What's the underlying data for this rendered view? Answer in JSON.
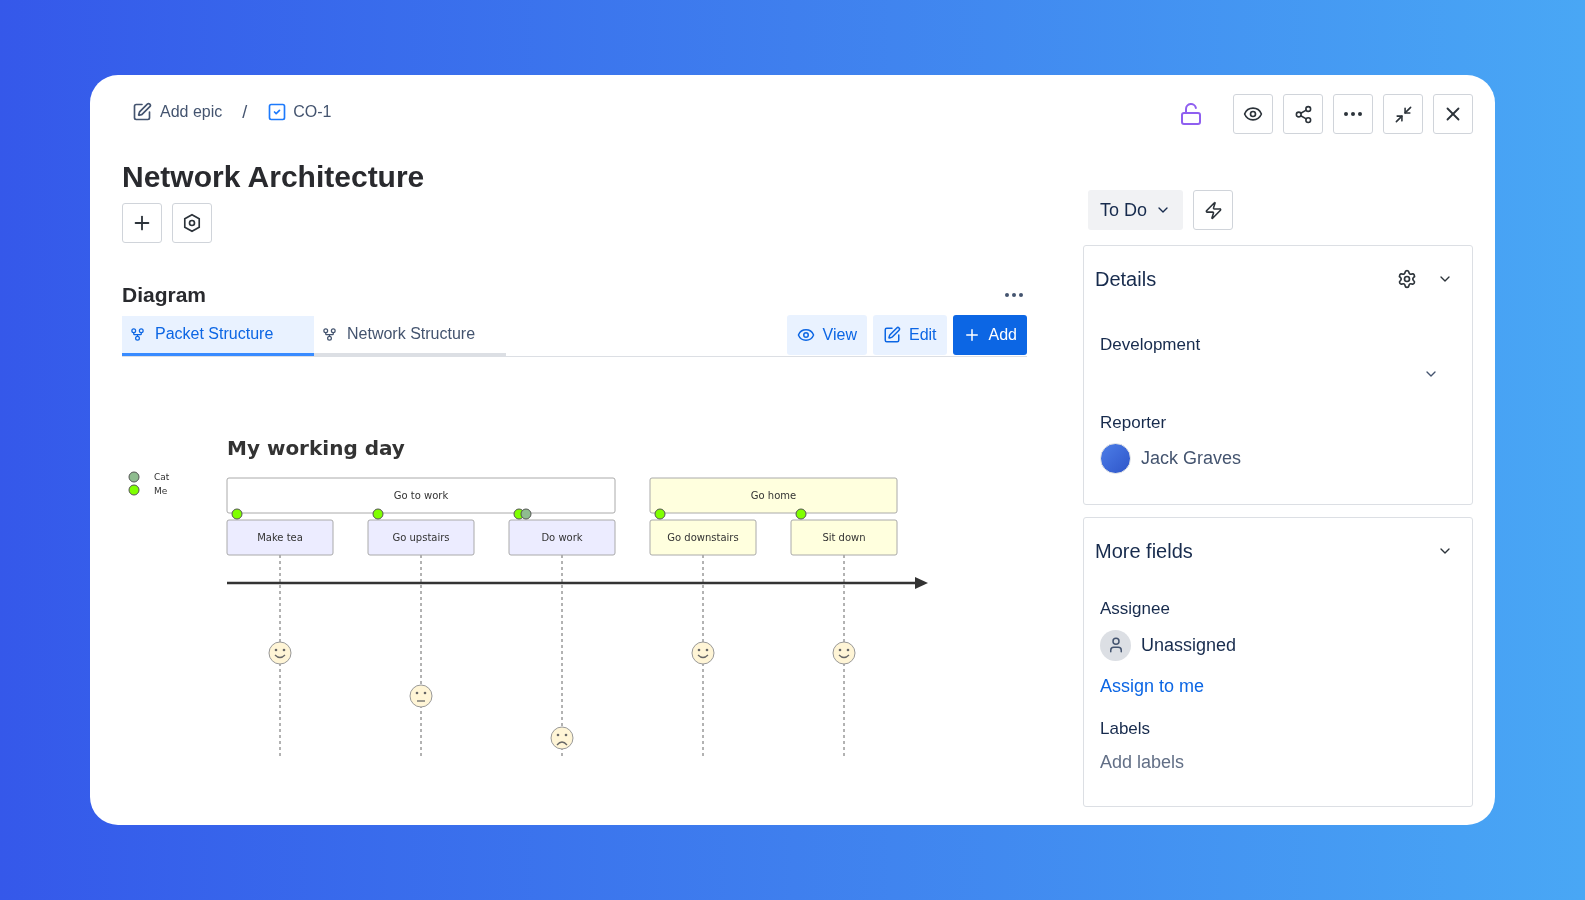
{
  "breadcrumb": {
    "parent": "Add epic",
    "separator": "/",
    "key": "CO-1"
  },
  "lock": {
    "locked": false
  },
  "title": "Network Architecture",
  "diagram": {
    "heading": "Diagram",
    "tabs": [
      {
        "label": "Packet Structure",
        "selected": true
      },
      {
        "label": "Network Structure",
        "selected": false
      }
    ],
    "actions": [
      {
        "label": "View",
        "kind": "view"
      },
      {
        "label": "Edit",
        "kind": "edit"
      },
      {
        "label": "Add",
        "kind": "add"
      }
    ],
    "journey": {
      "title": "My working day",
      "actors": [
        {
          "name": "Cat",
          "color": "#8fbc8f"
        },
        {
          "name": "Me",
          "color": "#7fff00"
        }
      ],
      "sections": [
        {
          "label": "Go to work",
          "color": "#ffffff",
          "tasks": [
            {
              "label": "Make tea",
              "kind": "happy",
              "color": "#ececff",
              "dots": [
                {
                  "color": "#7fff00"
                }
              ]
            },
            {
              "label": "Go upstairs",
              "kind": "neutral",
              "color": "#ececff",
              "dots": [
                {
                  "color": "#7fff00"
                }
              ]
            },
            {
              "label": "Do work",
              "kind": "sad",
              "color": "#ececff",
              "dots": [
                {
                  "color": "#7fff00"
                },
                {
                  "color": "#8fbc8f"
                }
              ]
            }
          ]
        },
        {
          "label": "Go home",
          "color": "#ffffde",
          "tasks": [
            {
              "label": "Go downstairs",
              "kind": "happy",
              "color": "#ffffde",
              "dots": [
                {
                  "color": "#7fff00"
                }
              ]
            },
            {
              "label": "Sit down",
              "kind": "happy",
              "color": "#ffffde",
              "dots": [
                {
                  "color": "#7fff00"
                }
              ]
            }
          ]
        }
      ]
    }
  },
  "status": {
    "label": "To Do"
  },
  "details": {
    "title": "Details",
    "development": {
      "label": "Development"
    },
    "reporter": {
      "label": "Reporter",
      "name": "Jack Graves"
    }
  },
  "more_fields": {
    "title": "More fields",
    "assignee": {
      "label": "Assignee",
      "value": "Unassigned",
      "link": "Assign to me"
    },
    "labels": {
      "label": "Labels",
      "placeholder": "Add labels"
    }
  }
}
